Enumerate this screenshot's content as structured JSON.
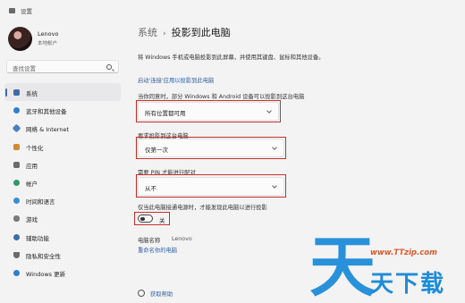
{
  "window": {
    "title": "设置"
  },
  "user": {
    "name": "Lenovo",
    "account_type": "本地帐户"
  },
  "search": {
    "placeholder": "查找设置"
  },
  "sidebar": {
    "items": [
      {
        "label": "系统",
        "icon": "monitor-icon",
        "color": "#3b6ea8",
        "active": true
      },
      {
        "label": "蓝牙和其他设备",
        "icon": "bluetooth-icon",
        "color": "#2f7fd0"
      },
      {
        "label": "网络 & Internet",
        "icon": "network-icon",
        "color": "#4a7fbf"
      },
      {
        "label": "个性化",
        "icon": "brush-icon",
        "color": "#d38a2c"
      },
      {
        "label": "应用",
        "icon": "apps-icon",
        "color": "#6b6b6b"
      },
      {
        "label": "帐户",
        "icon": "person-icon",
        "color": "#2e9c6a"
      },
      {
        "label": "时间和语言",
        "icon": "globe-clock-icon",
        "color": "#3a8fd4"
      },
      {
        "label": "游戏",
        "icon": "gamepad-icon",
        "color": "#7a7a7a"
      },
      {
        "label": "辅助功能",
        "icon": "accessibility-icon",
        "color": "#3b6ea8"
      },
      {
        "label": "隐私和安全性",
        "icon": "shield-icon",
        "color": "#6b6b6b"
      },
      {
        "label": "Windows 更新",
        "icon": "update-icon",
        "color": "#2f7fd0"
      }
    ]
  },
  "main": {
    "breadcrumb": {
      "parent": "系统",
      "separator": "›",
      "current": "投影到此电脑"
    },
    "description": "将 Windows 手机或电脑投影到此屏幕，并使用其键盘、鼠标和其他设备。",
    "optional_feature_link": "启动'连接'应用以投影到此电脑",
    "settings": [
      {
        "label": "当你同意时，部分 Windows 和 Android 设备可以投影到这台电脑",
        "value": "所有位置都可用"
      },
      {
        "label": "要求投影到这台电脑",
        "value": "仅第一次"
      },
      {
        "label": "需要 PIN 才能进行配对",
        "value": "从不"
      }
    ],
    "power_setting": {
      "label": "仅当此电脑接通电源时，才能发现此电脑以进行投影",
      "toggle_state": "关"
    },
    "pc_name": {
      "label": "电脑名称",
      "value": "Lenovo"
    },
    "rename_link": "重命名你的电脑",
    "help": "获取帮助"
  },
  "watermark": {
    "big_char": "天",
    "url": "www.TTzip.com",
    "chars": "天下载"
  },
  "colors": {
    "highlight": "#c9302c",
    "link": "#2f5fa8",
    "accent": "#3b6ea8"
  }
}
